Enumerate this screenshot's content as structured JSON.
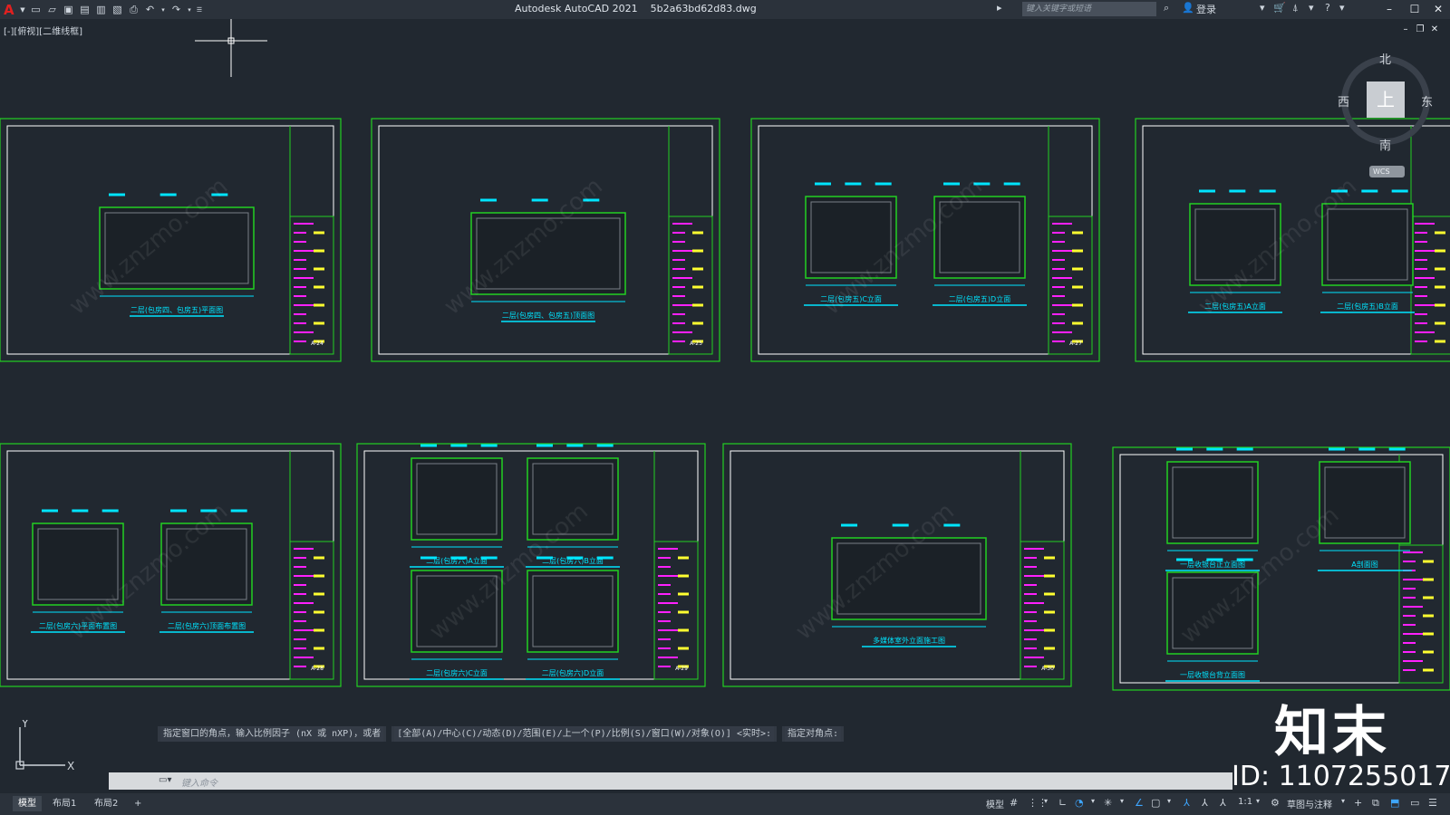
{
  "app": {
    "title": "Autodesk AutoCAD 2021",
    "filename": "5b2a63bd62d83.dwg",
    "logo": "A"
  },
  "search": {
    "placeholder": "键入关键字或短语"
  },
  "account": {
    "login": "登录"
  },
  "view_label": "[-][俯视][二维线框]",
  "viewcube": {
    "north": "北",
    "south": "南",
    "east": "东",
    "west": "西",
    "face": "上",
    "wcs": "WCS"
  },
  "command": {
    "history": [
      "指定窗口的角点，输入比例因子 (nX 或 nXP)，或者",
      "[全部(A)/中心(C)/动态(D)/范围(E)/上一个(P)/比例(S)/窗口(W)/对象(O)] <实时>:",
      "指定对角点:"
    ],
    "placeholder": "键入命令"
  },
  "layout_tabs": [
    "模型",
    "布局1",
    "布局2",
    "+"
  ],
  "status": {
    "model": "模型",
    "scale": "1:1",
    "workspace": "草图与注释"
  },
  "watermark": {
    "brand": "知末",
    "id": "ID: 1107255017",
    "site": "www.znzmo.com"
  },
  "sheets": [
    {
      "captions": [
        "二层(包房四、包房五)平面图"
      ],
      "tag": "A-24"
    },
    {
      "captions": [
        "二层(包房四、包房五)顶面图"
      ],
      "tag": "A-25"
    },
    {
      "captions": [
        "二层(包房五)C立面",
        "二层(包房五)D立面"
      ],
      "tag": "A-27"
    },
    {
      "captions": [
        "二层(包房五)A立面",
        "二层(包房五)B立面"
      ],
      "tag": ""
    },
    {
      "captions": [
        "二层(包房六)平面布置图",
        "二层(包房六)顶面布置图"
      ],
      "tag": "A-28"
    },
    {
      "captions": [
        "二层(包房六)A立面",
        "二层(包房六)B立面",
        "二层(包房六)C立面",
        "二层(包房六)D立面"
      ],
      "tag": "A-29"
    },
    {
      "captions": [
        "多媒体室外立面施工图"
      ],
      "tag": "A-30"
    },
    {
      "captions": [
        "一层收银台正立面图",
        "A剖面图",
        "一层收银台背立面图"
      ],
      "tag": ""
    }
  ],
  "colors": {
    "green": "#22d022",
    "cyan": "#00e5ff",
    "magenta": "#ff20ff",
    "yellow": "#ffff30",
    "bg": "#212830"
  }
}
